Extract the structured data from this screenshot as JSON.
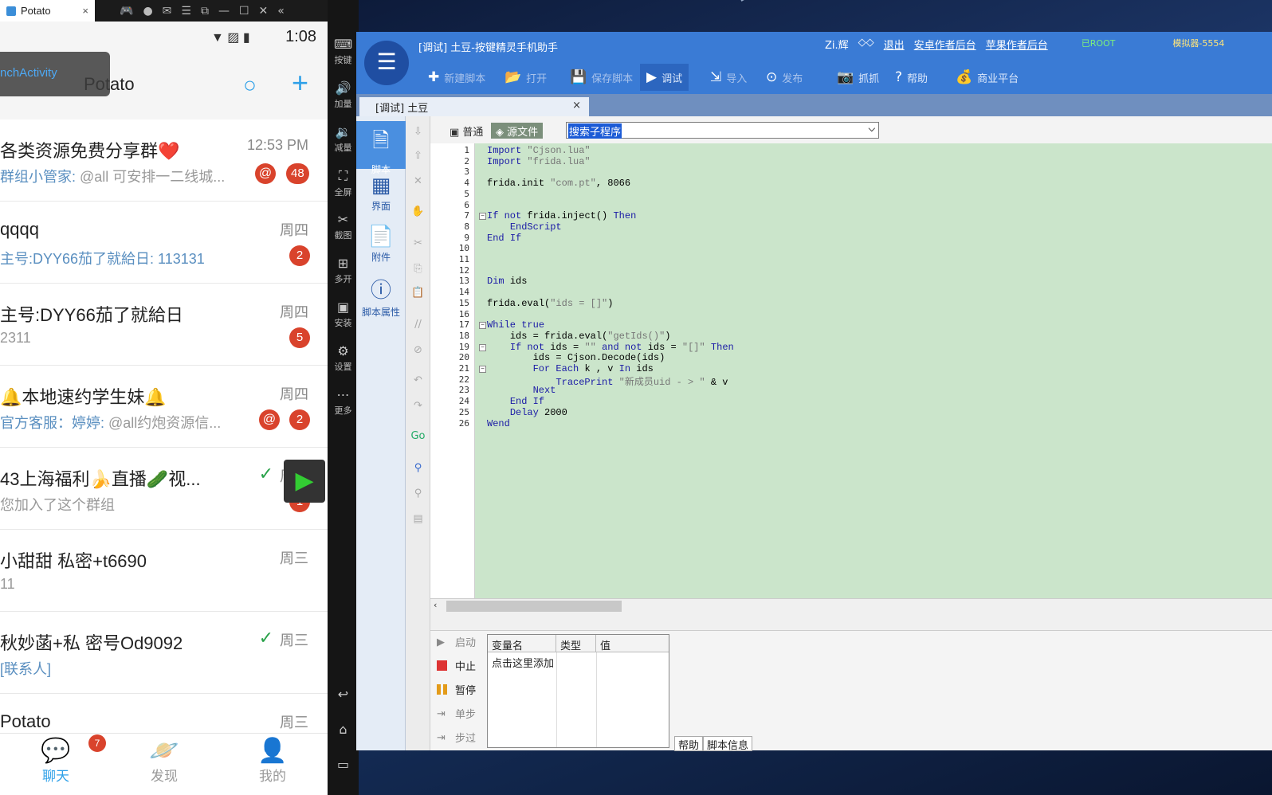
{
  "emulator": {
    "tab_title": "Potato",
    "tab_close": "×"
  },
  "phone": {
    "status_time": "1:08",
    "app_title": "Potato",
    "toast": "nchActivity",
    "chats": [
      {
        "name": "各类资源免费分享群❤️",
        "time": "12:53 PM",
        "who": "群组小管家:",
        "preview": " @all 可安排一二线城...",
        "badge": "48",
        "at": "@"
      },
      {
        "name": "qqqq",
        "time": "周四",
        "who": "",
        "preview": "主号:DYY66茄了就給日: 113131",
        "badge": "2",
        "at": ""
      },
      {
        "name": "主号:DYY66茄了就給日",
        "time": "周四",
        "who": "",
        "preview": "2311",
        "badge": "5",
        "at": ""
      },
      {
        "name": "🔔本地速约学生妹🔔",
        "time": "周四",
        "who": "官方客服：婷婷:",
        "preview": " @all约炮资源信...",
        "badge": "2",
        "at": "@"
      },
      {
        "name": "43上海福利🍌直播🥒视...",
        "time": "周四",
        "who": "",
        "preview": "您加入了这个群组",
        "badge": "1",
        "at": ""
      },
      {
        "name": "小甜甜 私密+t6690",
        "time": "周三",
        "who": "",
        "preview": "11",
        "badge": "",
        "at": ""
      },
      {
        "name": "秋妙菡+私 密号Od9092",
        "time": "周三",
        "who": "",
        "preview": "[联系人]",
        "badge": "",
        "at": ""
      },
      {
        "name": "Potato",
        "time": "周三",
        "who": "",
        "preview": "",
        "badge": "",
        "at": ""
      }
    ],
    "tabs": [
      {
        "label": "聊天",
        "badge": "7"
      },
      {
        "label": "发现"
      },
      {
        "label": "我的"
      }
    ]
  },
  "sidebar": [
    "按键",
    "加量",
    "减量",
    "全屏",
    "截图",
    "多开",
    "安装",
    "设置",
    "更多"
  ],
  "ide": {
    "title": "[调试] 土豆-按键精灵手机助手",
    "user": "Zi.辉",
    "logout": "退出",
    "android_link": "安卓作者后台",
    "apple_link": "苹果作者后台",
    "root": "已ROOT",
    "emulator": "模拟器-5554",
    "toolbar": [
      "新建脚本",
      "打开",
      "保存脚本",
      "调试",
      "导入",
      "发布",
      "抓抓",
      "帮助",
      "商业平台"
    ],
    "doc_tab": "[调试] 土豆",
    "left_nav": [
      "脚本",
      "界面",
      "附件",
      "脚本属性"
    ],
    "mode_normal": "普通",
    "mode_source": "源文件",
    "search_combo": "搜索子程序",
    "code_lines": [
      "Import \"Cjson.lua\"",
      "Import \"frida.lua\"",
      "",
      "frida.init \"com.pt\", 8066",
      "",
      "",
      "If not frida.inject() Then",
      "    EndScript",
      "End If",
      "",
      "",
      "",
      "Dim ids",
      "",
      "frida.eval(\"ids = []\")",
      "",
      "While true",
      "    ids = frida.eval(\"getIds()\")",
      "    If not ids = \"\" and not ids = \"[]\" Then",
      "        ids = Cjson.Decode(ids)",
      "        For Each k , v In ids",
      "            TracePrint \"新成员uid - > \" & v",
      "        Next",
      "    End If",
      "    Delay 2000",
      "Wend"
    ],
    "debug_buttons": [
      "启动",
      "中止",
      "暂停",
      "单步",
      "步过"
    ],
    "var_headers": [
      "变量名",
      "类型",
      "值"
    ],
    "var_add": "点击这里添加",
    "bottom_tabs": [
      "帮助",
      "脚本信息"
    ]
  }
}
